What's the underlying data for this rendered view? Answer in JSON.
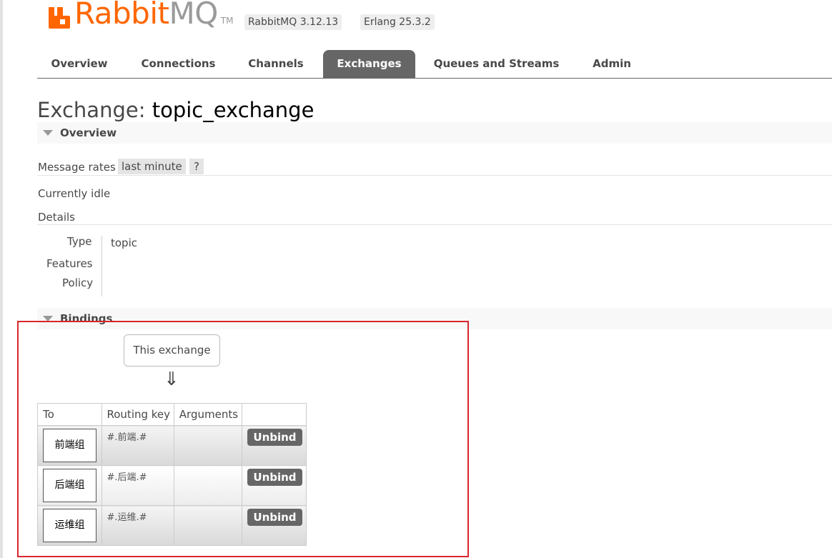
{
  "header": {
    "logo_rabbit": "Rabbit",
    "logo_mq": "MQ",
    "logo_tm": "TM",
    "version": "RabbitMQ 3.12.13",
    "erlang": "Erlang 25.3.2",
    "brand_color": "#ff6600"
  },
  "tabs": [
    {
      "label": "Overview",
      "active": false
    },
    {
      "label": "Connections",
      "active": false
    },
    {
      "label": "Channels",
      "active": false
    },
    {
      "label": "Exchanges",
      "active": true
    },
    {
      "label": "Queues and Streams",
      "active": false
    },
    {
      "label": "Admin",
      "active": false
    }
  ],
  "title": {
    "prefix": "Exchange:",
    "name": "topic_exchange"
  },
  "overview": {
    "header": "Overview",
    "message_rates_label": "Message rates",
    "rate_period": "last minute",
    "help": "?",
    "status": "Currently idle",
    "details_label": "Details",
    "details": {
      "type_label": "Type",
      "type_value": "topic",
      "features_label": "Features",
      "policy_label": "Policy"
    }
  },
  "bindings": {
    "header": "Bindings",
    "this_exchange": "This exchange",
    "arrow": "⇓",
    "columns": [
      "To",
      "Routing key",
      "Arguments",
      ""
    ],
    "rows": [
      {
        "to": "前端组",
        "routing_key": "#.前端.#",
        "arguments": "",
        "action": "Unbind"
      },
      {
        "to": "后端组",
        "routing_key": "#.后端.#",
        "arguments": "",
        "action": "Unbind"
      },
      {
        "to": "运维组",
        "routing_key": "#.运维.#",
        "arguments": "",
        "action": "Unbind"
      }
    ]
  }
}
